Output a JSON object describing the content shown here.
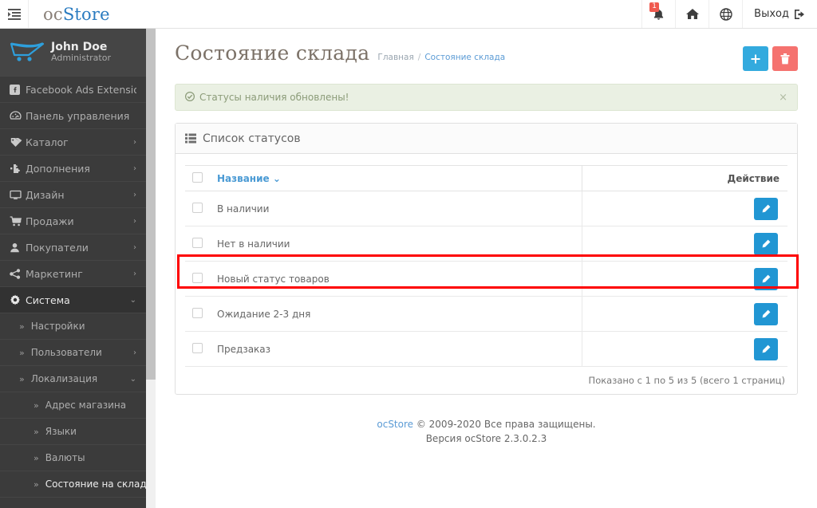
{
  "header": {
    "toggle_icon": "sidebar-toggle-icon",
    "brand_prefix": "oc",
    "brand_suffix": "Store",
    "notifications": {
      "icon": "bell-icon",
      "badge": "1"
    },
    "storefront": {
      "icon": "home-icon"
    },
    "language": {
      "icon": "globe-icon"
    },
    "logout": {
      "label": "Выход",
      "icon": "logout-icon"
    }
  },
  "sidebar": {
    "profile": {
      "name": "John Doe",
      "role": "Administrator",
      "logo_icon": "cart-logo-icon"
    },
    "items": [
      {
        "label": "Facebook Ads Extension›",
        "icon": "facebook-icon",
        "caret": "",
        "active": false
      },
      {
        "label": "Панель управления",
        "icon": "dashboard-icon",
        "caret": "",
        "active": false
      },
      {
        "label": "Каталог",
        "icon": "tag-icon",
        "caret": "›",
        "active": false
      },
      {
        "label": "Дополнения",
        "icon": "puzzle-icon",
        "caret": "›",
        "active": false
      },
      {
        "label": "Дизайн",
        "icon": "monitor-icon",
        "caret": "›",
        "active": false
      },
      {
        "label": "Продажи",
        "icon": "cart-icon",
        "caret": "›",
        "active": false
      },
      {
        "label": "Покупатели",
        "icon": "user-icon",
        "caret": "›",
        "active": false
      },
      {
        "label": "Маркетинг",
        "icon": "share-icon",
        "caret": "›",
        "active": false
      },
      {
        "label": "Система",
        "icon": "gear-icon",
        "caret": "⌄",
        "active": true
      }
    ],
    "sub_items": [
      {
        "label": "Настройки",
        "caret": "",
        "level": 1,
        "current": false
      },
      {
        "label": "Пользователи",
        "caret": "›",
        "level": 1,
        "current": false
      },
      {
        "label": "Локализация",
        "caret": "⌄",
        "level": 1,
        "current": false
      },
      {
        "label": "Адрес магазина",
        "caret": "",
        "level": 2,
        "current": false
      },
      {
        "label": "Языки",
        "caret": "",
        "level": 2,
        "current": false
      },
      {
        "label": "Валюты",
        "caret": "",
        "level": 2,
        "current": false
      },
      {
        "label": "Состояние на складе",
        "caret": "",
        "level": 2,
        "current": true
      }
    ]
  },
  "page": {
    "title": "Состояние склада",
    "breadcrumb": [
      {
        "label": "Главная",
        "current": false
      },
      {
        "label": "Состояние склада",
        "current": true
      }
    ],
    "breadcrumb_separator": "/",
    "actions": {
      "add_label": "",
      "add_icon": "plus-icon",
      "delete_label": "",
      "delete_icon": "trash-icon"
    },
    "alert": {
      "icon": "check-circle-icon",
      "text": "Статусы наличия обновлены!",
      "close": "×"
    },
    "panel": {
      "icon": "list-icon",
      "title": "Список статусов"
    },
    "table": {
      "columns": [
        {
          "key": "chk",
          "label": ""
        },
        {
          "key": "name",
          "label": "Название",
          "sort_icon": "⌄"
        },
        {
          "key": "action",
          "label": "Действие"
        }
      ],
      "rows": [
        {
          "name": "В наличии",
          "edit_icon": "pencil-icon",
          "highlighted": false
        },
        {
          "name": "Нет в наличии",
          "edit_icon": "pencil-icon",
          "highlighted": false
        },
        {
          "name": "Новый статус товаров",
          "edit_icon": "pencil-icon",
          "highlighted": true
        },
        {
          "name": "Ожидание 2-3 дня",
          "edit_icon": "pencil-icon",
          "highlighted": false
        },
        {
          "name": "Предзаказ",
          "edit_icon": "pencil-icon",
          "highlighted": false
        }
      ],
      "results": "Показано с 1 по 5 из 5 (всего 1 страниц)"
    },
    "footer": {
      "link": "ocStore",
      "copyright": " © 2009-2020 Все права защищены.",
      "version": "Версия ocStore 2.3.0.2.3"
    }
  },
  "colors": {
    "accent_blue": "#2196d3",
    "add_button": "#33aade",
    "delete_button": "#f5726f",
    "highlight_border": "#fe0000",
    "sidebar_bg": "#3b3b3b",
    "alert_bg": "#eaf0e3"
  }
}
